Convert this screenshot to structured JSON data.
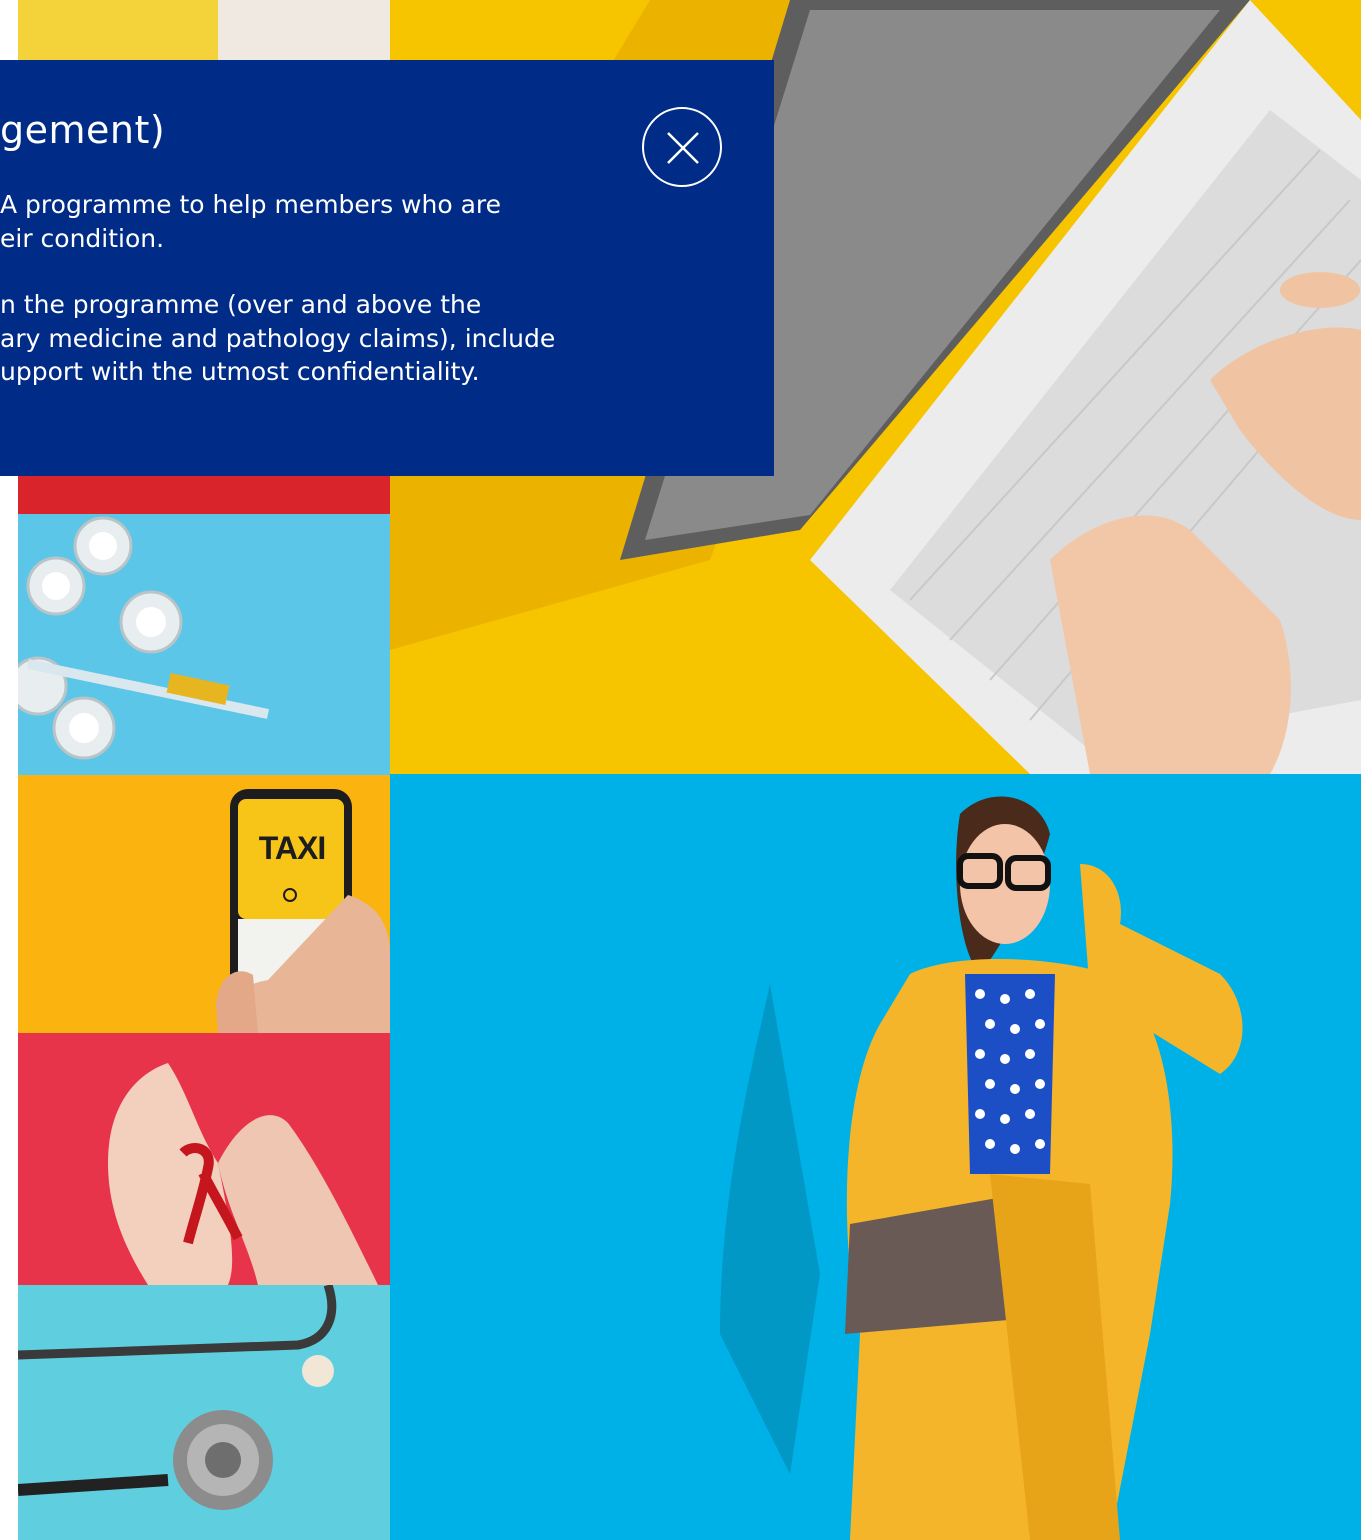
{
  "modal": {
    "title": "gement)",
    "paragraph1": [
      "A programme to help members who are",
      "eir condition."
    ],
    "paragraph2": [
      "n the programme (over and above the",
      "ary medicine and pathology claims), include",
      "upport with the utmost confidentiality."
    ],
    "close_icon": "close-icon",
    "background_color": "#002c88"
  },
  "gallery": {
    "tiles": [
      {
        "name": "photo-top-left",
        "subject": "yellow-top-partial"
      },
      {
        "name": "photo-laptop",
        "subject": "hands-typing-laptop",
        "background": "#f7c400"
      },
      {
        "name": "photo-red-strip",
        "subject": "red-background",
        "background": "#d9242b"
      },
      {
        "name": "photo-vials",
        "subject": "vials-and-syringe",
        "background": "#5cc6e8"
      },
      {
        "name": "photo-taxi-phone",
        "subject": "taxi-app-phone",
        "background": "#fbb40f"
      },
      {
        "name": "photo-ribbon",
        "subject": "hands-red-ribbon",
        "background": "#e8344a"
      },
      {
        "name": "photo-stethoscope",
        "subject": "stethoscope",
        "background": "#5fcfe0"
      },
      {
        "name": "photo-woman",
        "subject": "woman-yellow-suit",
        "background": "#00b1e8"
      }
    ],
    "phone_screen_text": "TAXI"
  }
}
